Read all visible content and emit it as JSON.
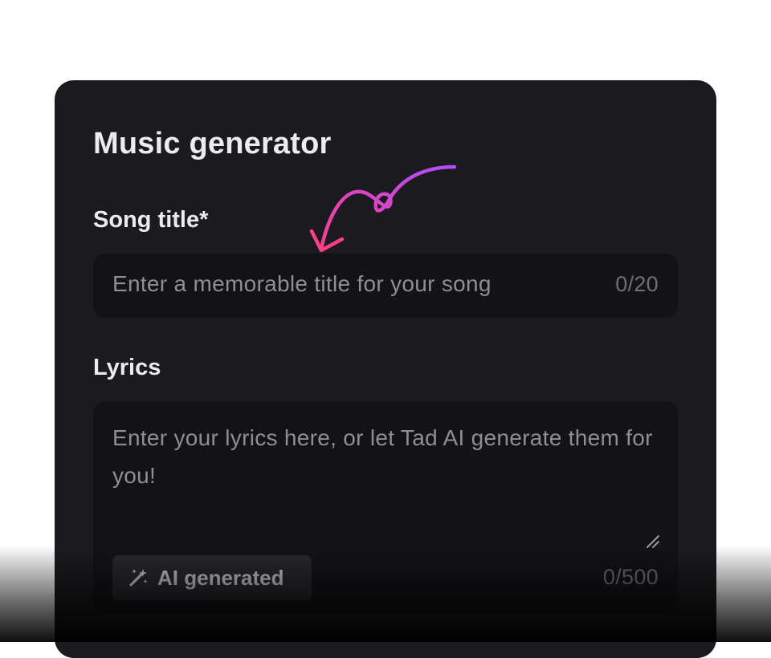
{
  "form": {
    "title": "Music generator",
    "song_title": {
      "label": "Song title*",
      "placeholder": "Enter a memorable title for your song",
      "counter": "0/20"
    },
    "lyrics": {
      "label": "Lyrics",
      "placeholder": "Enter your lyrics here, or let Tad AI generate them for you!",
      "counter": "0/500",
      "ai_button_label": "AI generated"
    }
  },
  "icons": {
    "ai_button_icon": "magic-wand-icon",
    "resize_icon": "resize-handle-icon",
    "annotation": "curly-arrow-icon"
  },
  "colors": {
    "card_background": "#1b1b1f",
    "field_background": "#131317",
    "text_primary": "#ececef",
    "placeholder": "#8e8e93",
    "arrow_gradient_start": "#ff3d8b",
    "arrow_gradient_end": "#b14dff"
  }
}
